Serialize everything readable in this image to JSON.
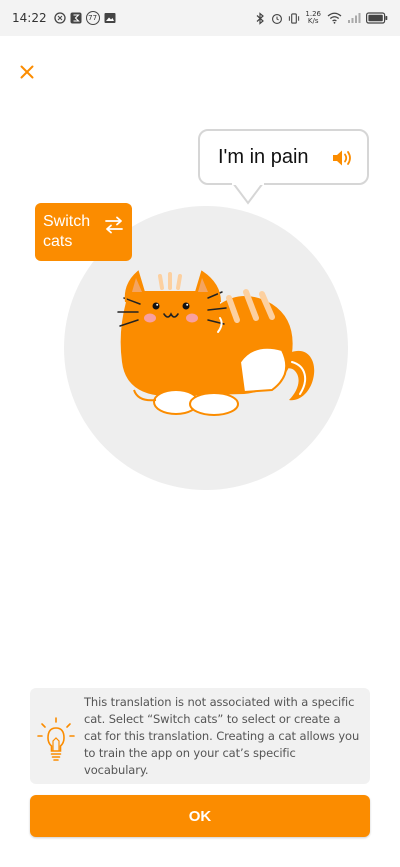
{
  "status_bar": {
    "time": "14:22",
    "notification_badge": "77",
    "net_speed_value": "1.26",
    "net_speed_unit": "K/s"
  },
  "icons": {
    "close": "close-icon",
    "speaker": "speaker-icon",
    "switch": "swap-arrows-icon",
    "tip": "lightbulb-icon"
  },
  "colors": {
    "accent": "#fb8c00",
    "bubble_border": "#d6d6d6",
    "circle_bg": "#eeeeee",
    "card_bg": "#f1f1f1"
  },
  "translation": {
    "text": "I'm in pain"
  },
  "switch_cats": {
    "label": "Switch cats"
  },
  "info": {
    "text": "This translation is not associated with a specific cat. Select “Switch cats” to select or create a cat for this translation. Creating a cat allows you to train the app on your cat’s specific vocabulary."
  },
  "ok_button": {
    "label": "OK"
  }
}
